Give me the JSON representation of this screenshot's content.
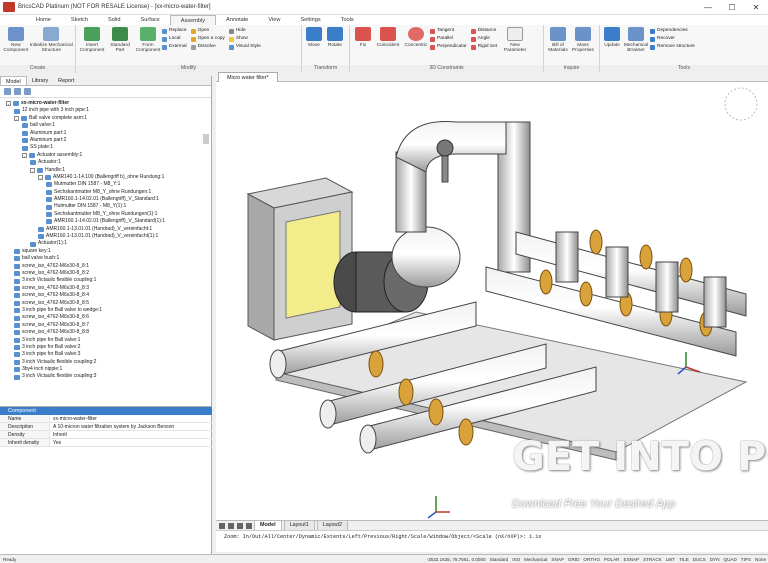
{
  "window": {
    "title": "BricsCAD Platinum (NOT FOR RESALE License) - [xx-micro-water-filter]",
    "min": "—",
    "max": "☐",
    "close": "✕"
  },
  "ribbon_tabs": [
    "Home",
    "Sketch",
    "Solid",
    "Surface",
    "Assembly",
    "Annotate",
    "View",
    "Settings",
    "Tools"
  ],
  "ribbon": {
    "create": {
      "label": "Create",
      "new_component": "New Component",
      "init_structure": "Initialize Mechanical Structure"
    },
    "modify": {
      "label": "Modify",
      "insert": "Insert Component",
      "standard": "Standard Part",
      "form": "Form Component",
      "replace": "Replace",
      "local": "Local",
      "external": "External",
      "open": "Open",
      "open_copy": "Open a copy",
      "dissolve": "Dissolve",
      "hide": "Hide",
      "show": "Show",
      "visual": "Visual Style"
    },
    "transform": {
      "label": "Transform",
      "move": "Move",
      "rotate": "Rotate"
    },
    "constraints": {
      "label": "3D Constraints",
      "fix": "Fix",
      "coincident": "Coincident",
      "concentric": "Concentric",
      "tangent": "Tangent",
      "parallel": "Parallel",
      "perpendicular": "Perpendicular",
      "distance": "Distance",
      "angle": "Angle",
      "rigid": "Rigid Set",
      "new_param": "New Parameter"
    },
    "inquire": {
      "label": "Inquire",
      "bom": "Bill of Materials",
      "mass": "Mass Properties"
    },
    "tools": {
      "label": "Tools",
      "update": "Update",
      "browser": "Mechanical Browser",
      "dependencies": "Dependencies",
      "recover": "Recover",
      "remove": "Remove structure"
    }
  },
  "panel_tabs": [
    "Model",
    "Library",
    "Report"
  ],
  "tree": [
    {
      "t": "xx-micro-water-filter",
      "d": 0,
      "ex": "⊟",
      "sel": true
    },
    {
      "t": "12 inch pipe with 3 inch pipe:1",
      "d": 1
    },
    {
      "t": "Ball valve complete asm:1",
      "d": 1,
      "ex": "⊟"
    },
    {
      "t": "ball valve:1",
      "d": 2
    },
    {
      "t": "Aluminum part:1",
      "d": 2
    },
    {
      "t": "Aluminum part:2",
      "d": 2
    },
    {
      "t": "SS plate:1",
      "d": 2
    },
    {
      "t": "Actuator assembly:1",
      "d": 2,
      "ex": "⊟"
    },
    {
      "t": "Actuator:1",
      "d": 3
    },
    {
      "t": "Handle:1",
      "d": 3,
      "ex": "⊟"
    },
    {
      "t": "AMR140.1-14.100 (Ballengriff b)_ohne Rundung:1",
      "d": 4,
      "ex": "⊟"
    },
    {
      "t": "Mutmutter DIN 1587 - M8_Y:1",
      "d": 5
    },
    {
      "t": "Sechskantmutter M8_Y_ohne Rundungen:1",
      "d": 5
    },
    {
      "t": "AMR160.1-14.02.01 (Ballengriff)_V_Standard:1",
      "d": 5
    },
    {
      "t": "Hutmutter DIN 1587 - M8_Y(1):1",
      "d": 5
    },
    {
      "t": "Sechskantmutter M8_Y_ohne Rundungen(1):1",
      "d": 5
    },
    {
      "t": "AMR160.1-14.02.01 (Ballengriff)_V_Standard(1):1",
      "d": 5
    },
    {
      "t": "AMR160.1-13.01.01 (Handrad)_V_vereinfacht:1",
      "d": 4
    },
    {
      "t": "AMR160.1-13.01.01 (Handrad)_V_vereinfacht(1):1",
      "d": 4
    },
    {
      "t": "Actuator(1):1",
      "d": 3
    },
    {
      "t": "square key:1",
      "d": 1
    },
    {
      "t": "ball valve bush:1",
      "d": 1
    },
    {
      "t": "screw_iso_4762-M6x30-8_8:1",
      "d": 1
    },
    {
      "t": "screw_iso_4762-M6x30-8_8:2",
      "d": 1
    },
    {
      "t": "3 inch Victaulic flexible coupling:1",
      "d": 1
    },
    {
      "t": "screw_iso_4762-M6x30-8_8:3",
      "d": 1
    },
    {
      "t": "screw_iso_4762-M6x30-8_8:4",
      "d": 1
    },
    {
      "t": "screw_iso_4762-M6x30-8_8:5",
      "d": 1
    },
    {
      "t": "3 inch pipe for Ball valve to wedge:1",
      "d": 1
    },
    {
      "t": "screw_iso_4762-M6x30-8_8:6",
      "d": 1
    },
    {
      "t": "screw_iso_4762-M6x30-8_8:7",
      "d": 1
    },
    {
      "t": "screw_iso_4762-M6x30-8_8:8",
      "d": 1
    },
    {
      "t": "3 inch pipe for Ball valve:1",
      "d": 1
    },
    {
      "t": "3 inch pipe for Ball valve:2",
      "d": 1
    },
    {
      "t": "3 inch pipe for Ball valve:3",
      "d": 1
    },
    {
      "t": "3 inch Victaulic flexible coupling:2",
      "d": 1
    },
    {
      "t": "3by4 inch nipple:1",
      "d": 1
    },
    {
      "t": "3 inch Victaulic flexible coupling:3",
      "d": 1
    }
  ],
  "props": {
    "header": "Component",
    "rows": [
      {
        "k": "Name",
        "v": "xx-micro-water-filter"
      },
      {
        "k": "Description",
        "v": "A 10-micron water filtration system by Jackson Benson"
      },
      {
        "k": "Density",
        "v": "Inherit"
      },
      {
        "k": "Inherit density",
        "v": "Yes"
      }
    ]
  },
  "view_tab": "Micro water filter*",
  "layouts": [
    "Model",
    "Layout1",
    "Layout2"
  ],
  "command": "Zoom:  In/Out/All/Center/Dynamic/Extents/Left/Previous/Right/Scale/Window/Object/<Scale (nX/nXP)>: 1.1x",
  "status": {
    "ready": "Ready",
    "coords": "-2532.1635, 78.7561, 0.0000",
    "items": [
      "Standard",
      "ISO",
      "Mechanical",
      "SNAP",
      "GRID",
      "ORTHO",
      "POLAR",
      "ESNAP",
      "STRACK",
      "LWT",
      "TILE",
      "DUCS",
      "DYN",
      "QUAD",
      "TIPS",
      "None"
    ]
  },
  "watermark": {
    "main": "GET INTO PC",
    "sub": "Download Free Your Desired App"
  }
}
